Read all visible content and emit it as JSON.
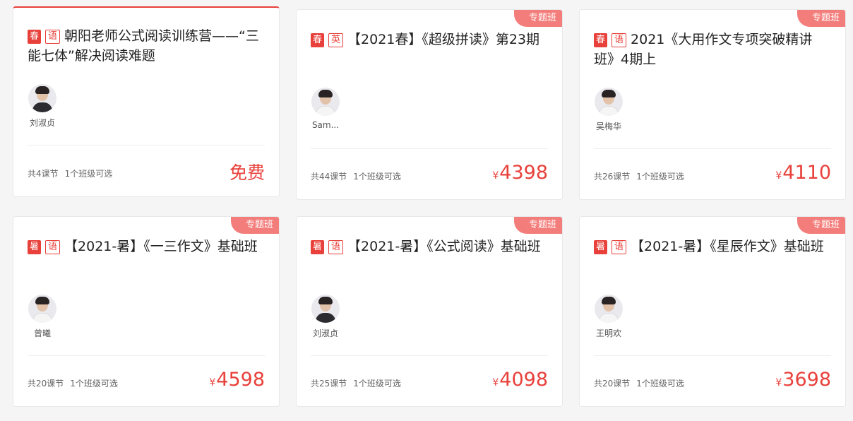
{
  "colors": {
    "accent": "#e8403a",
    "ribbon": "#f37d7b",
    "background": "#f5f5f5"
  },
  "currency_symbol": "¥",
  "courses": [
    {
      "season": "春",
      "subject": "语",
      "title": "朝阳老师公式阅读训练营——“三能七体”解决阅读难题",
      "ribbon": "",
      "teacher": "刘淑贞",
      "lessons": "共4课节",
      "classes": "1个班级可选",
      "price": "免费"
    },
    {
      "season": "春",
      "subject": "英",
      "title": "【2021春】《超级拼读》第23期",
      "ribbon": "专题班",
      "teacher": "Sam...",
      "lessons": "共44课节",
      "classes": "1个班级可选",
      "price": "4398"
    },
    {
      "season": "春",
      "subject": "语",
      "title": "2021《大用作文专项突破精讲班》4期上",
      "ribbon": "专题班",
      "teacher": "吴梅华",
      "lessons": "共26课节",
      "classes": "1个班级可选",
      "price": "4110"
    },
    {
      "season": "暑",
      "subject": "语",
      "title": "【2021-暑】《一三作文》基础班",
      "ribbon": "专题班",
      "teacher": "曾曦",
      "lessons": "共20课节",
      "classes": "1个班级可选",
      "price": "4598"
    },
    {
      "season": "暑",
      "subject": "语",
      "title": "【2021-暑】《公式阅读》基础班",
      "ribbon": "专题班",
      "teacher": "刘淑贞",
      "lessons": "共25课节",
      "classes": "1个班级可选",
      "price": "4098"
    },
    {
      "season": "暑",
      "subject": "语",
      "title": "【2021-暑】《星辰作文》基础班",
      "ribbon": "专题班",
      "teacher": "王明欢",
      "lessons": "共20课节",
      "classes": "1个班级可选",
      "price": "3698"
    }
  ]
}
